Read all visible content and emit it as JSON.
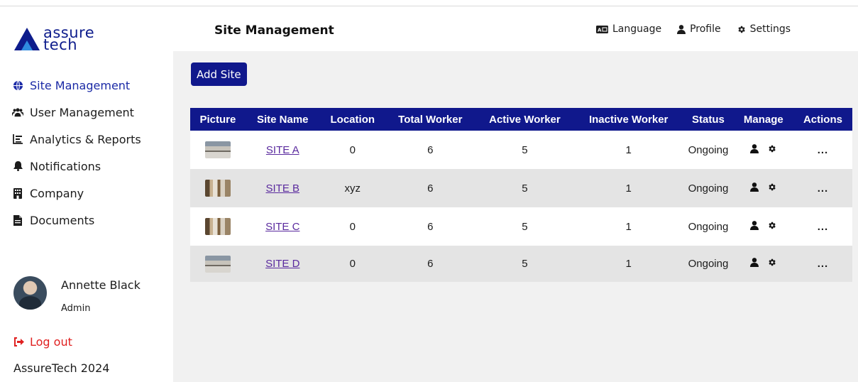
{
  "brand": {
    "logo_line1": "assure",
    "logo_line2": "tech",
    "accent": "#10188c"
  },
  "sidebar": {
    "items": [
      {
        "label": "Site Management",
        "icon": "globe-icon",
        "active": true
      },
      {
        "label": "User Management",
        "icon": "users-icon",
        "active": false
      },
      {
        "label": "Analytics & Reports",
        "icon": "chart-list-icon",
        "active": false
      },
      {
        "label": "Notifications",
        "icon": "bell-icon",
        "active": false
      },
      {
        "label": "Company",
        "icon": "building-icon",
        "active": false
      },
      {
        "label": "Documents",
        "icon": "file-icon",
        "active": false
      }
    ],
    "user": {
      "name": "Annette Black",
      "role": "Admin"
    },
    "logout_label": "Log out",
    "footer": "AssureTech 2024"
  },
  "header": {
    "title": "Site Management",
    "links": [
      {
        "label": "Language",
        "icon": "language-icon"
      },
      {
        "label": "Profile",
        "icon": "user-icon"
      },
      {
        "label": "Settings",
        "icon": "gear-icon"
      }
    ]
  },
  "toolbar": {
    "add_label": "Add Site"
  },
  "table": {
    "columns": [
      "Picture",
      "Site Name",
      "Location",
      "Total Worker",
      "Active Worker",
      "Inactive Worker",
      "Status",
      "Manage",
      "Actions"
    ],
    "rows": [
      {
        "name": "SITE A",
        "location": "0",
        "total": "6",
        "active": "5",
        "inactive": "1",
        "status": "Ongoing",
        "actions": "..."
      },
      {
        "name": "SITE B",
        "location": "xyz",
        "total": "6",
        "active": "5",
        "inactive": "1",
        "status": "Ongoing",
        "actions": "..."
      },
      {
        "name": "SITE C",
        "location": "0",
        "total": "6",
        "active": "5",
        "inactive": "1",
        "status": "Ongoing",
        "actions": "..."
      },
      {
        "name": "SITE D",
        "location": "0",
        "total": "6",
        "active": "5",
        "inactive": "1",
        "status": "Ongoing",
        "actions": "..."
      }
    ]
  }
}
